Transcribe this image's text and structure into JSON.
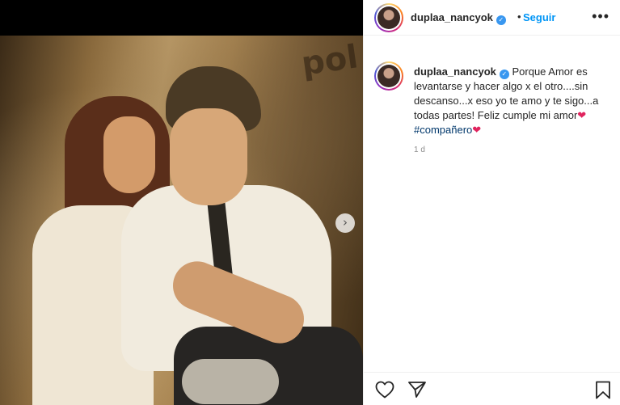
{
  "post": {
    "username": "duplaa_nancyok",
    "follow_label": "Seguir",
    "separator": "•",
    "more_label": "•••",
    "next_label": "›"
  },
  "caption": {
    "username": "duplaa_nancyok",
    "text": " Porque Amor es levantarse y hacer algo x el otro....sin descanso...x eso yo te amo y te sigo...a todas partes! Feliz cumple mi amor",
    "heart": "❤",
    "hashtag": "#compañero",
    "heart2": "❤"
  },
  "timestamp": "1 d",
  "photo": {
    "wall_text": "pol"
  },
  "icons": {
    "verified": "✓"
  }
}
